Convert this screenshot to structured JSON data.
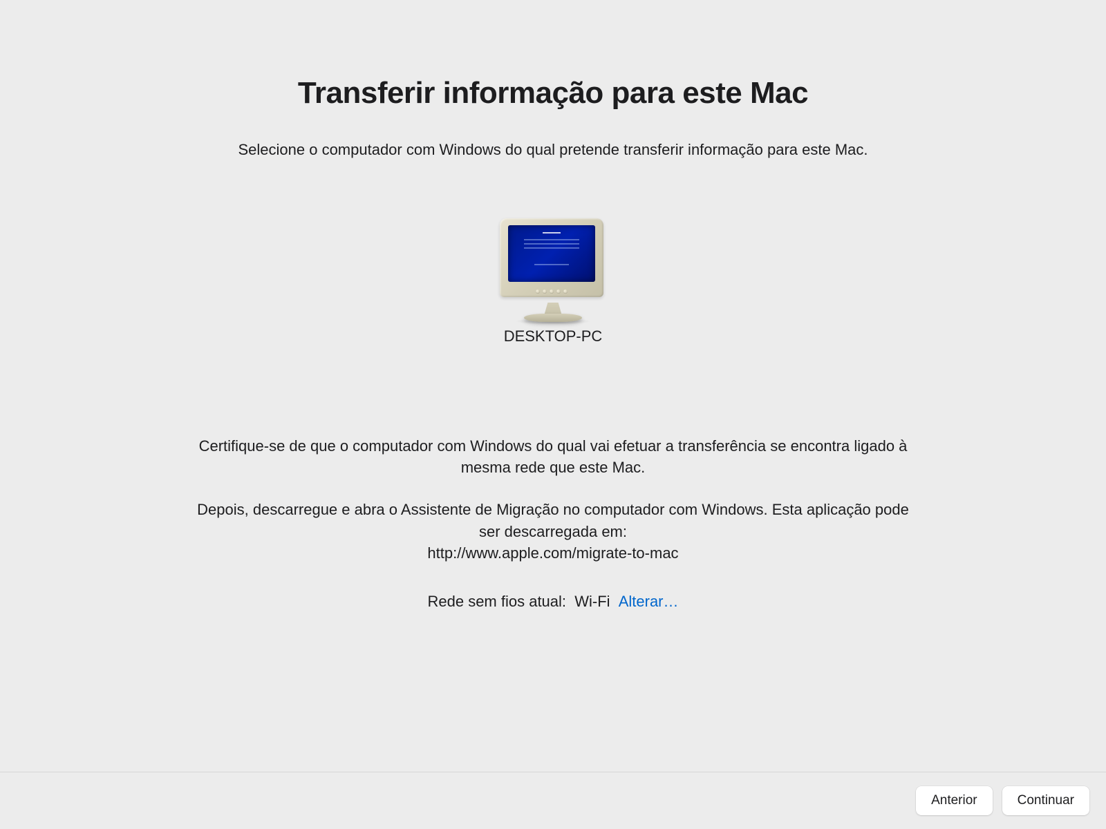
{
  "title": "Transferir informação para este Mac",
  "subtitle": "Selecione o computador com Windows do qual pretende transferir informação para este Mac.",
  "device": {
    "name": "DESKTOP-PC",
    "icon": "crt-pc-monitor"
  },
  "instructions": {
    "line1": "Certifique-se de que o computador com Windows do qual vai efetuar a transferência se encontra ligado à mesma rede que este Mac.",
    "line2": "Depois, descarregue e abra o Assistente de Migração no computador com Windows. Esta aplicação pode ser descarregada em:",
    "url": "http://www.apple.com/migrate-to-mac"
  },
  "network": {
    "label": "Rede sem fios atual:",
    "value": "Wi-Fi",
    "change_label": "Alterar…"
  },
  "buttons": {
    "back": "Anterior",
    "continue": "Continuar"
  }
}
